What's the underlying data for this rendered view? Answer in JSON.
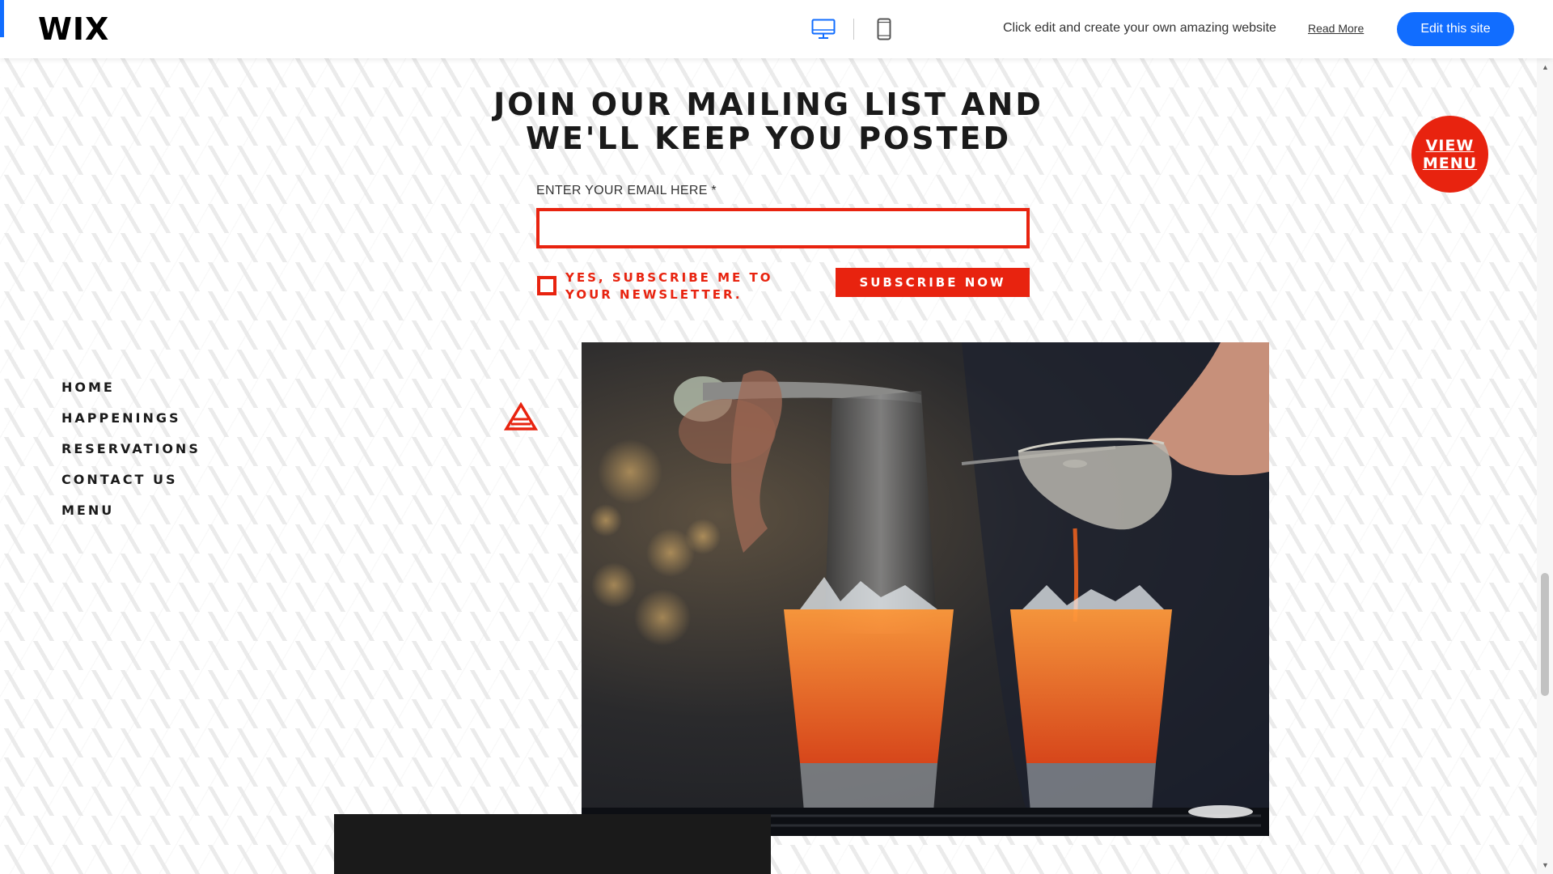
{
  "wix_bar": {
    "logo": "WIX",
    "promo_text": "Click edit and create your own amazing website",
    "read_more": "Read More",
    "edit_button": "Edit this site",
    "accent_color": "#116dff"
  },
  "signup": {
    "headline_line1": "JOIN OUR MAILING LIST AND",
    "headline_line2": "WE'LL KEEP YOU POSTED",
    "email_label": "ENTER YOUR EMAIL HERE *",
    "email_value": "",
    "checkbox_label": "YES, SUBSCRIBE ME TO YOUR NEWSLETTER.",
    "subscribe_button": "SUBSCRIBE NOW",
    "accent_color": "#e8230f"
  },
  "view_menu": {
    "label_line1": "VIEW",
    "label_line2": "MENU"
  },
  "nav": {
    "items": [
      "HOME",
      "HAPPENINGS",
      "RESERVATIONS",
      "CONTACT US",
      "MENU"
    ]
  },
  "icons": {
    "desktop": "desktop-icon",
    "mobile": "mobile-icon",
    "triangle": "triangle-logo-icon"
  }
}
